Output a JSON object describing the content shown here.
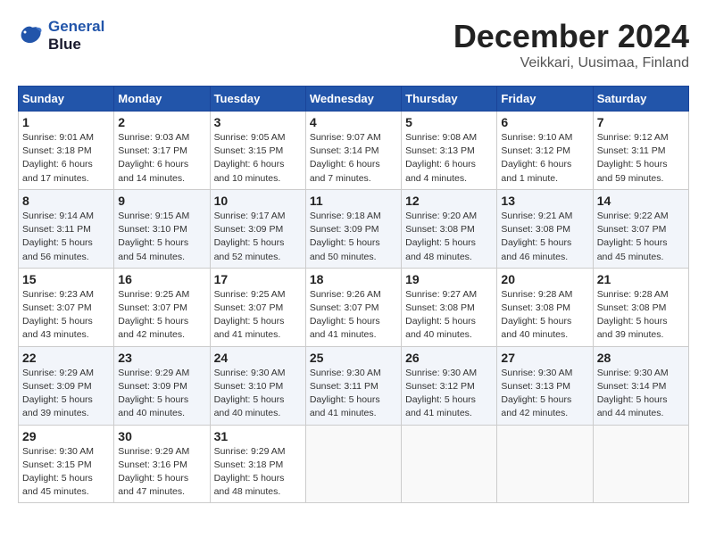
{
  "header": {
    "logo_line1": "General",
    "logo_line2": "Blue",
    "title": "December 2024",
    "subtitle": "Veikkari, Uusimaa, Finland"
  },
  "weekdays": [
    "Sunday",
    "Monday",
    "Tuesday",
    "Wednesday",
    "Thursday",
    "Friday",
    "Saturday"
  ],
  "weeks": [
    [
      {
        "day": "1",
        "info": "Sunrise: 9:01 AM\nSunset: 3:18 PM\nDaylight: 6 hours and 17 minutes."
      },
      {
        "day": "2",
        "info": "Sunrise: 9:03 AM\nSunset: 3:17 PM\nDaylight: 6 hours and 14 minutes."
      },
      {
        "day": "3",
        "info": "Sunrise: 9:05 AM\nSunset: 3:15 PM\nDaylight: 6 hours and 10 minutes."
      },
      {
        "day": "4",
        "info": "Sunrise: 9:07 AM\nSunset: 3:14 PM\nDaylight: 6 hours and 7 minutes."
      },
      {
        "day": "5",
        "info": "Sunrise: 9:08 AM\nSunset: 3:13 PM\nDaylight: 6 hours and 4 minutes."
      },
      {
        "day": "6",
        "info": "Sunrise: 9:10 AM\nSunset: 3:12 PM\nDaylight: 6 hours and 1 minute."
      },
      {
        "day": "7",
        "info": "Sunrise: 9:12 AM\nSunset: 3:11 PM\nDaylight: 5 hours and 59 minutes."
      }
    ],
    [
      {
        "day": "8",
        "info": "Sunrise: 9:14 AM\nSunset: 3:11 PM\nDaylight: 5 hours and 56 minutes."
      },
      {
        "day": "9",
        "info": "Sunrise: 9:15 AM\nSunset: 3:10 PM\nDaylight: 5 hours and 54 minutes."
      },
      {
        "day": "10",
        "info": "Sunrise: 9:17 AM\nSunset: 3:09 PM\nDaylight: 5 hours and 52 minutes."
      },
      {
        "day": "11",
        "info": "Sunrise: 9:18 AM\nSunset: 3:09 PM\nDaylight: 5 hours and 50 minutes."
      },
      {
        "day": "12",
        "info": "Sunrise: 9:20 AM\nSunset: 3:08 PM\nDaylight: 5 hours and 48 minutes."
      },
      {
        "day": "13",
        "info": "Sunrise: 9:21 AM\nSunset: 3:08 PM\nDaylight: 5 hours and 46 minutes."
      },
      {
        "day": "14",
        "info": "Sunrise: 9:22 AM\nSunset: 3:07 PM\nDaylight: 5 hours and 45 minutes."
      }
    ],
    [
      {
        "day": "15",
        "info": "Sunrise: 9:23 AM\nSunset: 3:07 PM\nDaylight: 5 hours and 43 minutes."
      },
      {
        "day": "16",
        "info": "Sunrise: 9:25 AM\nSunset: 3:07 PM\nDaylight: 5 hours and 42 minutes."
      },
      {
        "day": "17",
        "info": "Sunrise: 9:25 AM\nSunset: 3:07 PM\nDaylight: 5 hours and 41 minutes."
      },
      {
        "day": "18",
        "info": "Sunrise: 9:26 AM\nSunset: 3:07 PM\nDaylight: 5 hours and 41 minutes."
      },
      {
        "day": "19",
        "info": "Sunrise: 9:27 AM\nSunset: 3:08 PM\nDaylight: 5 hours and 40 minutes."
      },
      {
        "day": "20",
        "info": "Sunrise: 9:28 AM\nSunset: 3:08 PM\nDaylight: 5 hours and 40 minutes."
      },
      {
        "day": "21",
        "info": "Sunrise: 9:28 AM\nSunset: 3:08 PM\nDaylight: 5 hours and 39 minutes."
      }
    ],
    [
      {
        "day": "22",
        "info": "Sunrise: 9:29 AM\nSunset: 3:09 PM\nDaylight: 5 hours and 39 minutes."
      },
      {
        "day": "23",
        "info": "Sunrise: 9:29 AM\nSunset: 3:09 PM\nDaylight: 5 hours and 40 minutes."
      },
      {
        "day": "24",
        "info": "Sunrise: 9:30 AM\nSunset: 3:10 PM\nDaylight: 5 hours and 40 minutes."
      },
      {
        "day": "25",
        "info": "Sunrise: 9:30 AM\nSunset: 3:11 PM\nDaylight: 5 hours and 41 minutes."
      },
      {
        "day": "26",
        "info": "Sunrise: 9:30 AM\nSunset: 3:12 PM\nDaylight: 5 hours and 41 minutes."
      },
      {
        "day": "27",
        "info": "Sunrise: 9:30 AM\nSunset: 3:13 PM\nDaylight: 5 hours and 42 minutes."
      },
      {
        "day": "28",
        "info": "Sunrise: 9:30 AM\nSunset: 3:14 PM\nDaylight: 5 hours and 44 minutes."
      }
    ],
    [
      {
        "day": "29",
        "info": "Sunrise: 9:30 AM\nSunset: 3:15 PM\nDaylight: 5 hours and 45 minutes."
      },
      {
        "day": "30",
        "info": "Sunrise: 9:29 AM\nSunset: 3:16 PM\nDaylight: 5 hours and 47 minutes."
      },
      {
        "day": "31",
        "info": "Sunrise: 9:29 AM\nSunset: 3:18 PM\nDaylight: 5 hours and 48 minutes."
      },
      null,
      null,
      null,
      null
    ]
  ]
}
